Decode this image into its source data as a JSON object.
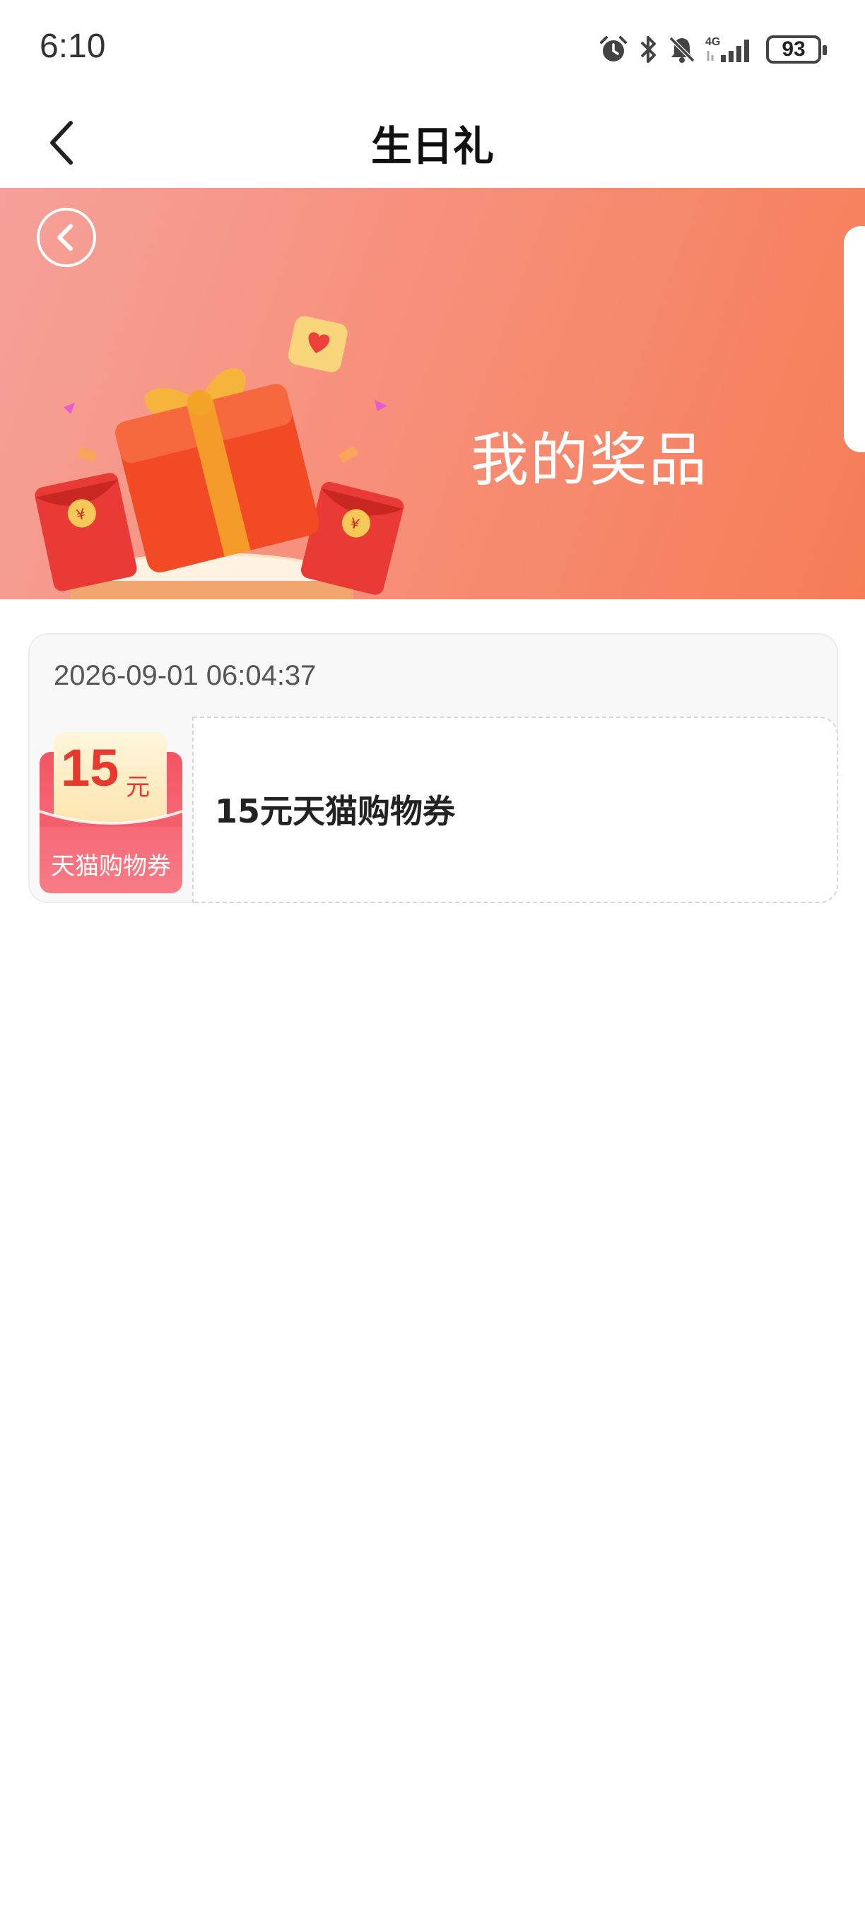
{
  "status_bar": {
    "time": "6:10",
    "network": "4G",
    "battery": "93",
    "icons": [
      "alarm-icon",
      "bluetooth-icon",
      "bell-muted-icon",
      "signal-icon",
      "battery-icon"
    ]
  },
  "header": {
    "title": "生日礼",
    "back_icon": "back-arrow-icon"
  },
  "banner": {
    "title": "我的奖品",
    "back_icon": "circle-back-icon",
    "illustration": "gift-box-illustration",
    "colors": {
      "start": "#f6a19a",
      "end": "#f57d56"
    }
  },
  "prize": {
    "time": "2026-09-01 06:04:37",
    "coupon": {
      "amount": "15",
      "unit": "元",
      "label": "天猫购物券"
    },
    "name": "15元天猫购物券"
  }
}
